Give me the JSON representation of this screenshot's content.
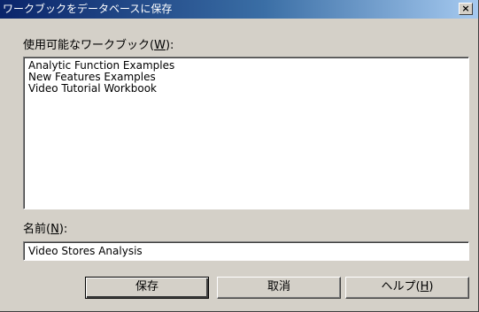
{
  "dialog": {
    "title": "ワークブックをデータベースに保存",
    "close_symbol": "×"
  },
  "workbooks": {
    "label_prefix": "使用可能なワークブック(",
    "label_mnemonic": "W",
    "label_suffix": "):",
    "items": [
      "Analytic Function Examples",
      "New Features Examples",
      "Video Tutorial Workbook"
    ]
  },
  "name": {
    "label_prefix": "名前(",
    "label_mnemonic": "N",
    "label_suffix": "):",
    "value": "Video Stores Analysis"
  },
  "buttons": {
    "save_label": "保存",
    "cancel_label": "取消",
    "help_prefix": "ヘルプ(",
    "help_mnemonic": "H",
    "help_suffix": ")"
  }
}
